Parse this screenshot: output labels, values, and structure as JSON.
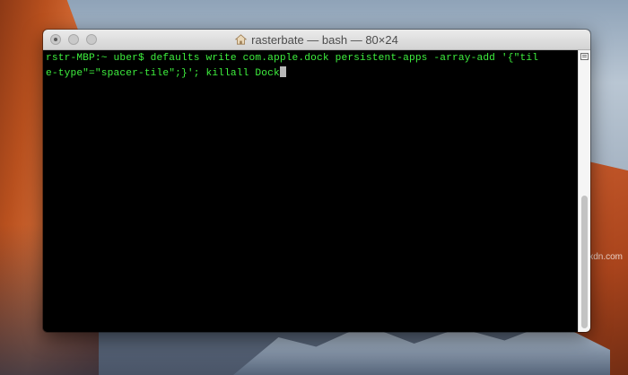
{
  "window": {
    "title": "rasterbate — bash — 80×24",
    "title_icon": "home-folder-icon"
  },
  "terminal": {
    "line1": "rstr-MBP:~ uber$ defaults write com.apple.dock persistent-apps -array-add '{\"til",
    "line2": "e-type\"=\"spacer-tile\";}'; killall Dock",
    "text_color": "#3ef03e",
    "background_color": "#000000"
  },
  "watermark": {
    "text": "wsxdn.com"
  }
}
